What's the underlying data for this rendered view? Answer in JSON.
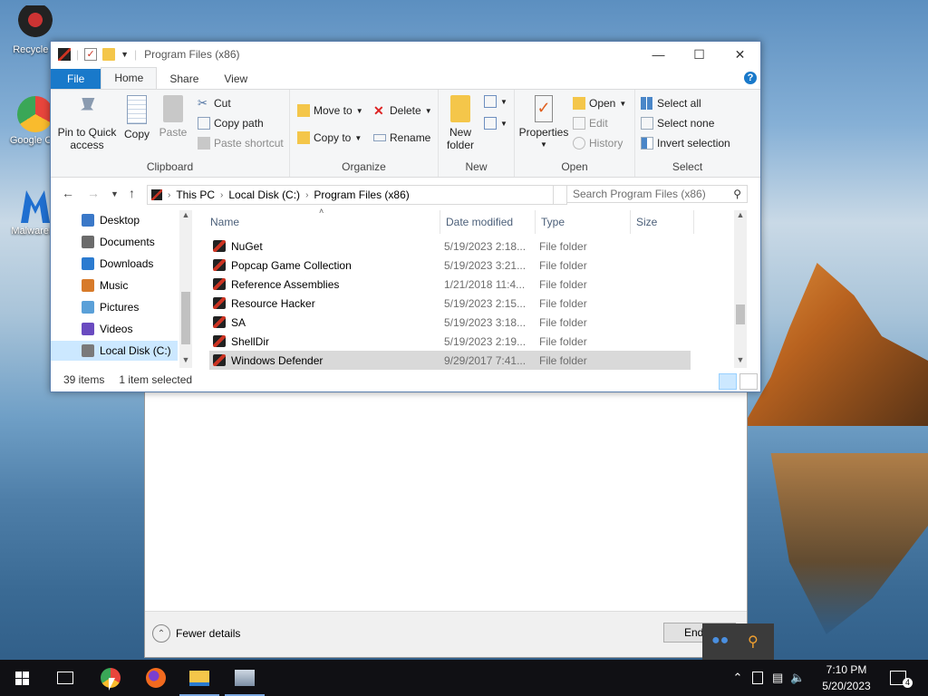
{
  "desktop": {
    "icons": [
      {
        "label": "Recycle Bin",
        "visible_label": "Recycle B",
        "color": "#c0c0c0"
      },
      {
        "label": "Google Chrome",
        "visible_label": "Google Chr",
        "color": "#e8453c"
      },
      {
        "label": "Malwarebytes",
        "visible_label": "Malwareby",
        "color": "#1f6fd0"
      }
    ]
  },
  "dialog": {
    "fewer_details": "Fewer details",
    "end_button": "End"
  },
  "window": {
    "title": "Program Files (x86)",
    "tabs": [
      "File",
      "Home",
      "Share",
      "View"
    ],
    "active_tab": "Home",
    "ribbon": {
      "clipboard": {
        "label": "Clipboard",
        "pin": "Pin to Quick access",
        "pin_l1": "Pin to Quick",
        "pin_l2": "access",
        "copy": "Copy",
        "paste": "Paste",
        "cut": "Cut",
        "copy_path": "Copy path",
        "paste_shortcut": "Paste shortcut"
      },
      "organize": {
        "label": "Organize",
        "move_to": "Move to",
        "copy_to": "Copy to",
        "delete": "Delete",
        "rename": "Rename"
      },
      "new": {
        "label": "New",
        "new_folder_l1": "New",
        "new_folder_l2": "folder"
      },
      "open": {
        "label": "Open",
        "properties": "Properties",
        "open": "Open",
        "edit": "Edit",
        "history": "History"
      },
      "select": {
        "label": "Select",
        "select_all": "Select all",
        "select_none": "Select none",
        "invert": "Invert selection"
      }
    },
    "address": {
      "crumbs": [
        "This PC",
        "Local Disk (C:)",
        "Program Files (x86)"
      ],
      "search_placeholder": "Search Program Files (x86)"
    },
    "nav_pane": {
      "items": [
        {
          "label": "Desktop",
          "color": "#3a78c8"
        },
        {
          "label": "Documents",
          "color": "#6b6b6b"
        },
        {
          "label": "Downloads",
          "color": "#2b7bd0"
        },
        {
          "label": "Music",
          "color": "#d77a2a"
        },
        {
          "label": "Pictures",
          "color": "#5aa0d8"
        },
        {
          "label": "Videos",
          "color": "#6a4bc0"
        },
        {
          "label": "Local Disk (C:)",
          "color": "#7a7a7a"
        }
      ],
      "selected": "Local Disk (C:)"
    },
    "columns": [
      "Name",
      "Date modified",
      "Type",
      "Size"
    ],
    "rows": [
      {
        "name": "NuGet",
        "date": "5/19/2023 2:18...",
        "type": "File folder"
      },
      {
        "name": "Popcap Game Collection",
        "date": "5/19/2023 3:21...",
        "type": "File folder"
      },
      {
        "name": "Reference Assemblies",
        "date": "1/21/2018 11:4...",
        "type": "File folder"
      },
      {
        "name": "Resource Hacker",
        "date": "5/19/2023 2:15...",
        "type": "File folder"
      },
      {
        "name": "SA",
        "date": "5/19/2023 3:18...",
        "type": "File folder"
      },
      {
        "name": "ShellDir",
        "date": "5/19/2023 2:19...",
        "type": "File folder"
      },
      {
        "name": "Windows Defender",
        "date": "9/29/2017 7:41...",
        "type": "File folder"
      }
    ],
    "selected_row": "Windows Defender",
    "status": {
      "items": "39 items",
      "selected": "1 item selected"
    }
  },
  "taskbar": {
    "apps": [
      "start",
      "task-view",
      "chrome",
      "firefox",
      "file-explorer",
      "photos"
    ],
    "time": "7:10 PM",
    "date": "5/20/2023",
    "notifications": "4"
  }
}
